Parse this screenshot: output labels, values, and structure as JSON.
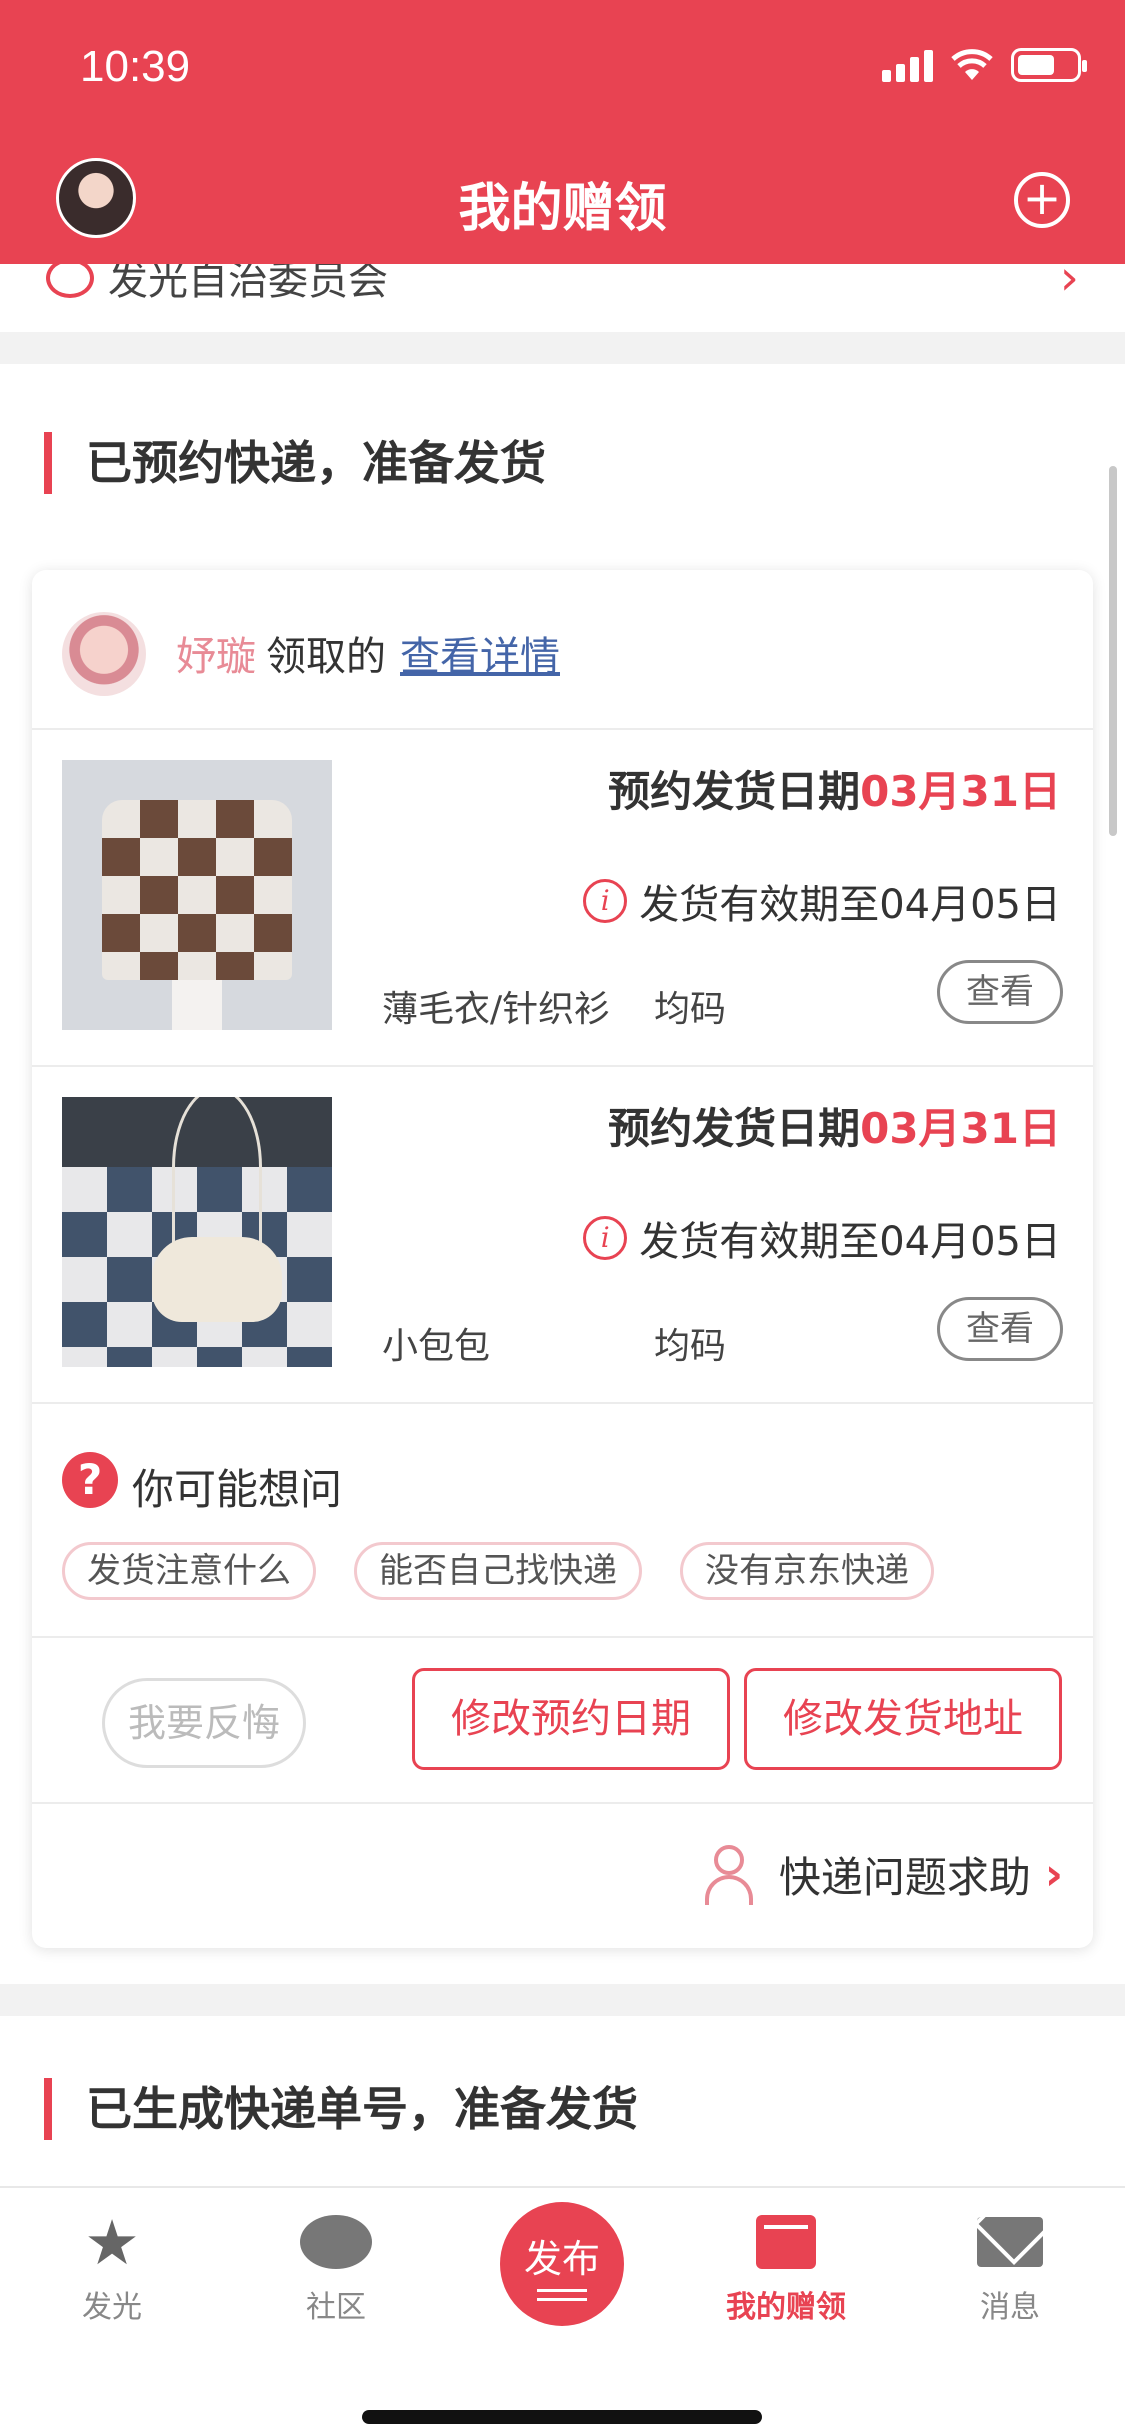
{
  "status": {
    "time": "10:39"
  },
  "header": {
    "title": "我的赠领",
    "add_icon": "plus-circle-icon"
  },
  "top_row": {
    "label": "发光自治委员会"
  },
  "section1": {
    "title": "已预约快递，准备发货",
    "card": {
      "giver_name": "妤璇",
      "giver_action": "领取的",
      "giver_link": "查看详情",
      "items": [
        {
          "date_prefix": "预约发货日期",
          "date_value": "03月31日",
          "valid_text": "发货有效期至04月05日",
          "name": "薄毛衣/针织衫",
          "size": "均码",
          "view": "查看"
        },
        {
          "date_prefix": "预约发货日期",
          "date_value": "03月31日",
          "valid_text": "发货有效期至04月05日",
          "name": "小包包",
          "size": "均码",
          "view": "查看"
        }
      ],
      "faq": {
        "title": "你可能想问",
        "tags": [
          "发货注意什么",
          "能否自己找快递",
          "没有京东快递"
        ]
      },
      "actions": {
        "regret": "我要反悔",
        "modify_date": "修改预约日期",
        "modify_address": "修改发货地址"
      },
      "help": "快递问题求助"
    }
  },
  "section2": {
    "title": "已生成快递单号，准备发货"
  },
  "tabbar": {
    "tabs": [
      {
        "label": "发光",
        "icon": "star-icon"
      },
      {
        "label": "社区",
        "icon": "chat-bubble-icon"
      },
      {
        "label": "发布",
        "icon": "publish-icon"
      },
      {
        "label": "我的赠领",
        "icon": "book-icon",
        "active": true
      },
      {
        "label": "消息",
        "icon": "mail-icon"
      }
    ]
  },
  "colors": {
    "accent": "#e84352",
    "link": "#4465a8",
    "giver_name": "#e88b96"
  }
}
